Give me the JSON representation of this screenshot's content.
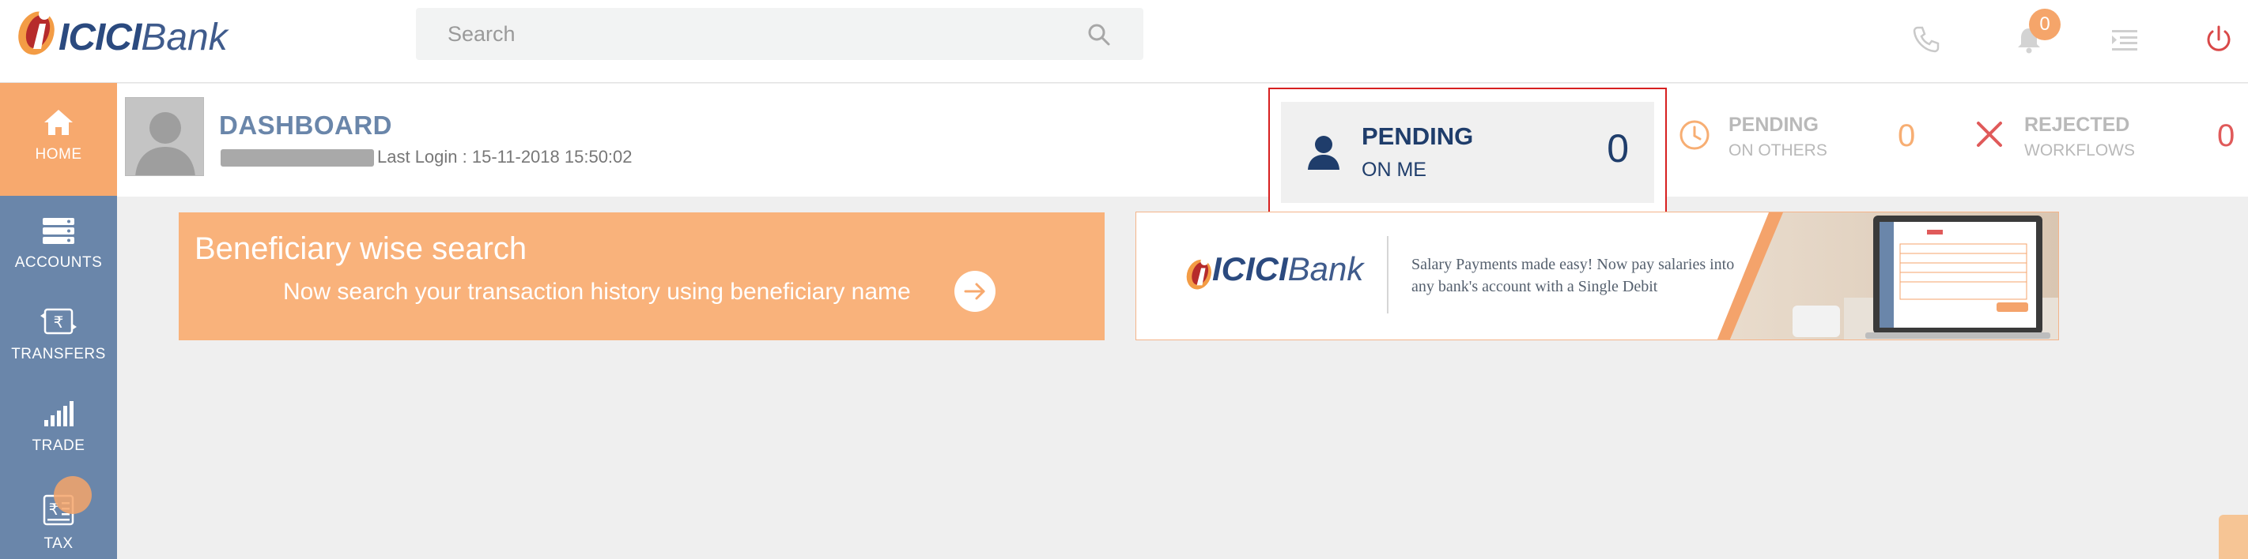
{
  "header": {
    "brand": {
      "mark": "ICICI",
      "word": "Bank"
    },
    "search": {
      "placeholder": "Search"
    },
    "notification_count": "0"
  },
  "sidebar": {
    "items": [
      {
        "label": "HOME",
        "icon": "home-icon",
        "active": true
      },
      {
        "label": "ACCOUNTS",
        "icon": "accounts-icon"
      },
      {
        "label": "TRANSFERS",
        "icon": "rupee-transfer-icon"
      },
      {
        "label": "TRADE",
        "icon": "bar-signal-icon"
      },
      {
        "label": "TAX",
        "icon": "rupee-receipt-icon"
      }
    ]
  },
  "dashboard": {
    "title": "DASHBOARD",
    "last_login": "Last Login : 15-11-2018 15:50:02",
    "pending_on_me": {
      "line1": "PENDING",
      "line2": "ON ME",
      "count": "0"
    },
    "pending_on_others": {
      "line1": "PENDING",
      "line2": "ON OTHERS",
      "count": "0"
    },
    "rejected": {
      "line1": "REJECTED",
      "line2": "WORKFLOWS",
      "count": "0"
    }
  },
  "banners": {
    "beneficiary": {
      "heading": "Beneficiary wise search",
      "sub": "Now search your transaction history using beneficiary name"
    },
    "salary": {
      "brand_mark": "ICICI",
      "brand_word": "Bank",
      "text": "Salary Payments made easy! Now pay salaries into any bank's account with a Single Debit"
    }
  },
  "colors": {
    "accent": "#f7a96e",
    "sidebar": "#6a86aa",
    "navy": "#1f3d6b",
    "danger": "#d72020"
  }
}
